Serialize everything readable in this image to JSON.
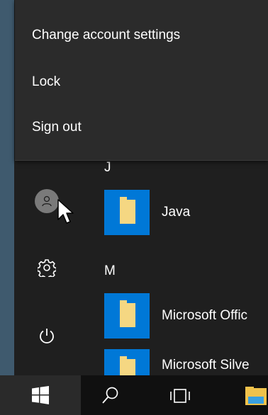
{
  "account_menu": {
    "items": [
      {
        "label": "Change account settings"
      },
      {
        "label": "Lock"
      },
      {
        "label": "Sign out"
      }
    ]
  },
  "groups": {
    "j": "J",
    "m": "M"
  },
  "apps": [
    {
      "label": "Java",
      "icon": "folder-icon"
    },
    {
      "label": "Microsoft Offic",
      "icon": "folder-icon"
    },
    {
      "label": "Microsoft Silve",
      "icon": "folder-icon"
    }
  ],
  "left_rail": {
    "user_icon": "user-avatar-icon",
    "settings_icon": "gear-icon",
    "power_icon": "power-icon"
  },
  "taskbar": {
    "start_icon": "windows-logo-icon",
    "search_icon": "search-icon",
    "task_view_icon": "task-view-icon",
    "explorer_icon": "file-explorer-icon"
  },
  "colors": {
    "menu_bg": "#2b2b2b",
    "start_bg": "#1f1f1f",
    "tile_accent": "#0078d7",
    "folder": "#f5d782",
    "taskbar_bg": "#101010"
  }
}
